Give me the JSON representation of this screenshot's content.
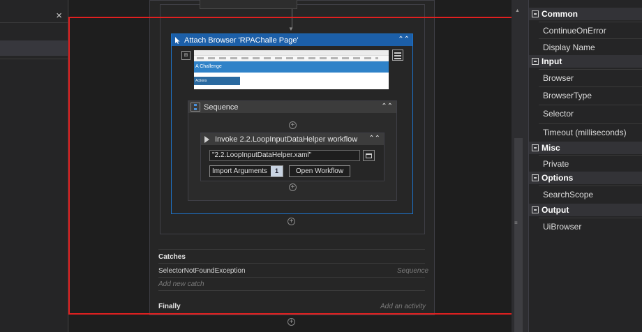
{
  "left_panel": {
    "close_glyph": "×"
  },
  "canvas": {
    "attach_browser": {
      "title": "Attach Browser 'RPAChalle Page'",
      "collapse_glyph": "⌃⌃",
      "preview": {
        "hero_text": "A Challenge",
        "table_first_col": "Actions"
      }
    },
    "sequence": {
      "title": "Sequence",
      "collapse_glyph": "⌃⌃"
    },
    "invoke": {
      "title": "Invoke 2.2.LoopInputDataHelper workflow",
      "collapse_glyph": "⌃⌃",
      "file_value": "\"2.2.LoopInputDataHelper.xaml\"",
      "import_label": "Import Arguments",
      "import_count": "1",
      "open_label": "Open Workflow"
    },
    "catches": {
      "title": "Catches",
      "items": [
        {
          "exception": "SelectorNotFoundException",
          "handler": "Sequence"
        }
      ],
      "add_new": "Add new catch"
    },
    "finally": {
      "title": "Finally",
      "placeholder": "Add an activity"
    },
    "plus_glyph": "+"
  },
  "properties": {
    "categories": [
      {
        "name": "Common",
        "items": [
          "ContinueOnError",
          "Display Name"
        ]
      },
      {
        "name": "Input",
        "items": [
          "Browser",
          "BrowserType",
          "Selector",
          "Timeout (milliseconds)"
        ]
      },
      {
        "name": "Misc",
        "items": [
          "Private"
        ]
      },
      {
        "name": "Options",
        "items": [
          "SearchScope"
        ]
      },
      {
        "name": "Output",
        "items": [
          "UiBrowser"
        ]
      }
    ]
  },
  "colors": {
    "accent": "#1c5fa8",
    "highlight_frame": "#e02020",
    "background": "#1e1e1e"
  }
}
